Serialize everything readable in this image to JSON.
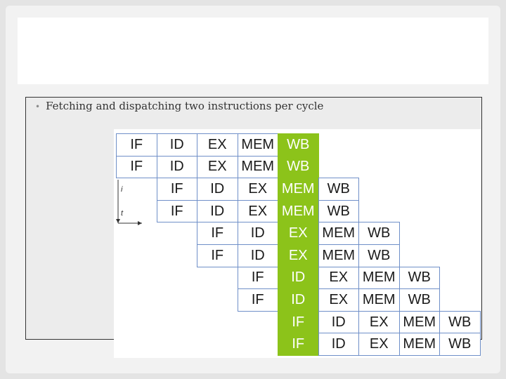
{
  "bullet": "Fetching and dispatching two instructions per cycle",
  "axis": {
    "vertical": "i",
    "horizontal": "t"
  },
  "pipeline": {
    "highlight_color": "#8cc31a",
    "rows": [
      [
        "IF",
        "ID",
        "EX",
        "MEM",
        "WB"
      ],
      [
        "IF",
        "ID",
        "EX",
        "MEM",
        "WB"
      ],
      [
        "IF",
        "ID",
        "EX",
        "MEM",
        "WB"
      ],
      [
        "IF",
        "ID",
        "EX",
        "MEM",
        "WB"
      ],
      [
        "IF",
        "ID",
        "EX",
        "MEM",
        "WB"
      ],
      [
        "IF",
        "ID",
        "EX",
        "MEM",
        "WB"
      ],
      [
        "IF",
        "ID",
        "EX",
        "MEM",
        "WB"
      ],
      [
        "IF",
        "ID",
        "EX",
        "MEM",
        "WB"
      ],
      [
        "IF",
        "ID",
        "EX",
        "MEM",
        "WB"
      ],
      [
        "IF",
        "ID",
        "EX",
        "MEM",
        "WB"
      ]
    ],
    "highlighted_column": 4
  }
}
